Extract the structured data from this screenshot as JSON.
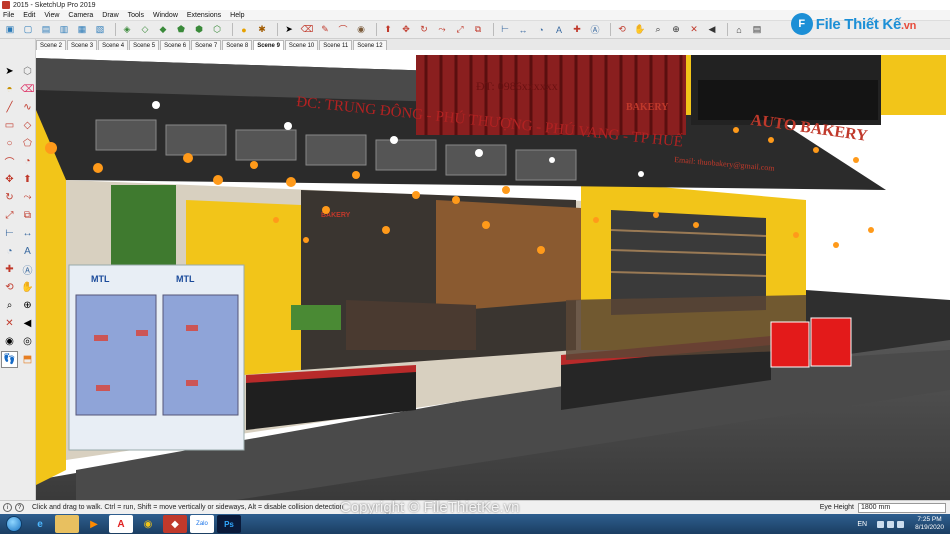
{
  "window": {
    "title": "2015 - SketchUp Pro 2019"
  },
  "menu": [
    "File",
    "Edit",
    "View",
    "Camera",
    "Draw",
    "Tools",
    "Window",
    "Extensions",
    "Help"
  ],
  "brand": {
    "text": "File Thiết Kế",
    "suffix": ".vn",
    "mark": "F"
  },
  "scenes": [
    "Scene 2",
    "Scene 3",
    "Scene 4",
    "Scene 5",
    "Scene 6",
    "Scene 7",
    "Scene 8",
    "Scene 9",
    "Scene 10",
    "Scene 11",
    "Scene 12"
  ],
  "active_scene": "Scene 9",
  "store": {
    "address": "ĐC: TRUNG ĐÔNG - PHÚ THƯỢNG - PHÚ VANG - TP HUẾ",
    "phone": "ĐT: 0986xxxxxx",
    "email": "Email: thuobakery@gmail.com",
    "sign_main": "AUTO BAKERY",
    "sign_small": "BAKERY",
    "sign_inner": "BAKERY",
    "fridge_brand": "MTL"
  },
  "status": {
    "message": "Click and drag to walk.  Ctrl = run, Shift = move vertically or sideways, Alt = disable collision detection",
    "eye_height_label": "Eye Height",
    "eye_height_value": "1800 mm"
  },
  "watermark": "Copyright © FileThietKe.vn",
  "taskbar": {
    "language": "EN",
    "time": "7:25 PM",
    "date": "8/19/2020"
  },
  "colors": {
    "wall_yellow": "#f2c519",
    "ceiling_dark": "#2b2b2b",
    "floor_gray": "#3f3f3f",
    "red_case": "#e31a1a"
  }
}
